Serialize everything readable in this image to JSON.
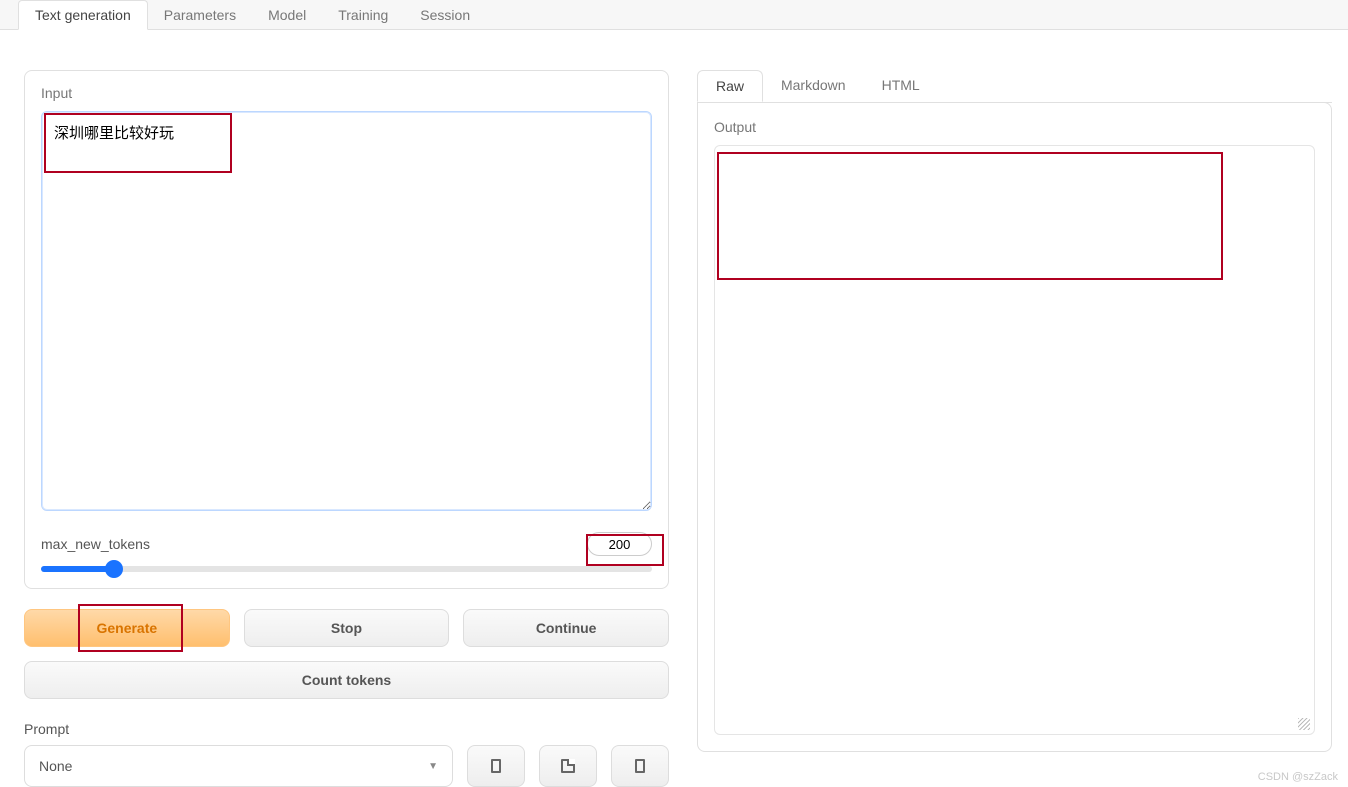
{
  "topTabs": {
    "textGeneration": "Text generation",
    "parameters": "Parameters",
    "model": "Model",
    "training": "Training",
    "session": "Session"
  },
  "input": {
    "label": "Input",
    "value": "深圳哪里比较好玩"
  },
  "slider": {
    "label": "max_new_tokens",
    "value": "200"
  },
  "buttons": {
    "generate": "Generate",
    "stop": "Stop",
    "continue": "Continue",
    "count": "Count tokens"
  },
  "prompt": {
    "label": "Prompt",
    "selected": "None"
  },
  "subTabs": {
    "raw": "Raw",
    "markdown": "Markdown",
    "html": "HTML"
  },
  "output": {
    "label": "Output",
    "value": ""
  },
  "watermark": "CSDN @szZack"
}
